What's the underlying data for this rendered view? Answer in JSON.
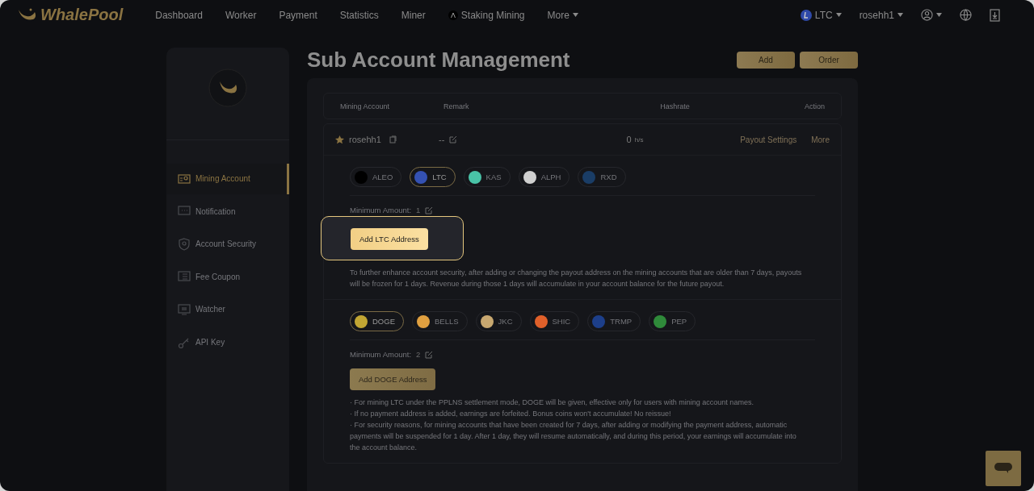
{
  "nav": {
    "logo": "WhalePool",
    "items": [
      {
        "label": "Dashboard",
        "kind": "link"
      },
      {
        "label": "Worker",
        "kind": "link"
      },
      {
        "label": "Payment",
        "kind": "link"
      },
      {
        "label": "Statistics",
        "kind": "link"
      },
      {
        "label": "Miner",
        "kind": "link"
      },
      {
        "label": "Staking Mining",
        "kind": "coin"
      },
      {
        "label": "More",
        "kind": "dropdown"
      }
    ],
    "coin": "LTC",
    "user": "rosehh1"
  },
  "page_title": "Sub Account Management",
  "header_buttons": [
    "Add",
    "Order"
  ],
  "sidebar": {
    "items": [
      {
        "label": "Mining Account",
        "selected": true,
        "kind": "account"
      },
      {
        "label": "Notification",
        "selected": false,
        "kind": "message"
      },
      {
        "label": "Account Security",
        "selected": false,
        "kind": "shield"
      },
      {
        "label": "Fee Coupon",
        "selected": false,
        "kind": "coupon"
      },
      {
        "label": "Watcher",
        "selected": false,
        "kind": "monitor"
      },
      {
        "label": "API Key",
        "selected": false,
        "kind": "key"
      }
    ]
  },
  "table": {
    "columns": [
      "Mining Account",
      "Remark",
      "Hashrate",
      "Action"
    ],
    "row": {
      "account": "rosehh1",
      "remark": "--",
      "hashrate": "0",
      "unit": "h/s",
      "actions": [
        "Payout Settings",
        "More"
      ]
    }
  },
  "coin_groups": [
    {
      "coins": [
        {
          "label": "ALEO",
          "selected": false,
          "color": "#000000"
        },
        {
          "label": "LTC",
          "selected": true,
          "color": "#3451b2"
        },
        {
          "label": "KAS",
          "selected": false,
          "color": "#49c3a7"
        },
        {
          "label": "ALPH",
          "selected": false,
          "color": "#d0d0d0"
        },
        {
          "label": "RXD",
          "selected": false,
          "color": "#1a3d66"
        }
      ],
      "min_label": "Minimum Amount:",
      "min_value": "1",
      "button": "Add LTC Address",
      "highlighted": true,
      "notes": [
        "To further enhance account security, after adding or changing the payout address on the mining accounts that are older than 7 days, payouts will be frozen for 1 days. Revenue during those 1 days will accumulate in your account balance for the future payout."
      ]
    },
    {
      "coins": [
        {
          "label": "DOGE",
          "selected": true,
          "color": "#c2a633"
        },
        {
          "label": "BELLS",
          "selected": false,
          "color": "#e0a040"
        },
        {
          "label": "JKC",
          "selected": false,
          "color": "#c8a870"
        },
        {
          "label": "SHIC",
          "selected": false,
          "color": "#e0602a"
        },
        {
          "label": "TRMP",
          "selected": false,
          "color": "#1d3f8a"
        },
        {
          "label": "PEP",
          "selected": false,
          "color": "#2f8a3a"
        }
      ],
      "min_label": "Minimum Amount:",
      "min_value": "2",
      "button": "Add DOGE Address",
      "highlighted": false,
      "notes": [
        "· For mining LTC under the PPLNS settlement mode, DOGE will be given, effective only for users with mining account names.",
        "· If no payment address is added, earnings are forfeited. Bonus coins won't accumulate! No reissue!",
        "· For security reasons, for mining accounts that have been created for 7 days, after adding or modifying the payment address, automatic payments will be suspended for 1 day. After 1 day, they will resume automatically, and during this period, your earnings will accumulate into the account balance."
      ]
    }
  ]
}
